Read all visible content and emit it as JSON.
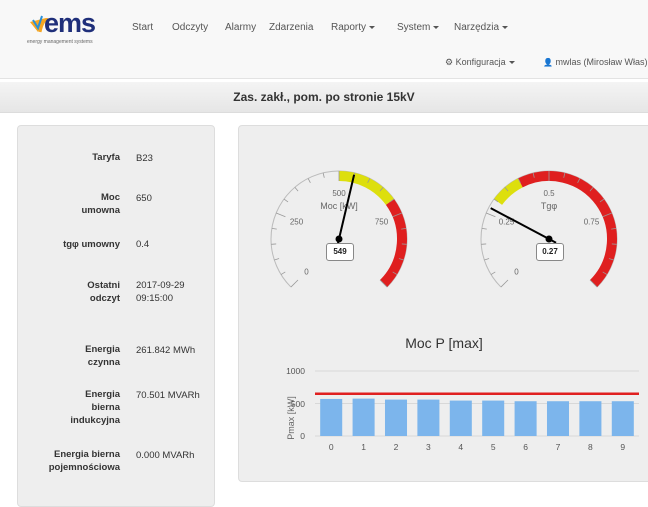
{
  "brand": {
    "name": "ems",
    "subtitle": "energy management systems"
  },
  "nav": {
    "items": [
      "Start",
      "Odczyty",
      "Alarmy",
      "Zdarzenia",
      "Raporty",
      "System",
      "Narzędzia"
    ],
    "config_label": "Konfiguracja",
    "user_label": "mwlas (Mirosław Włas)"
  },
  "page_title": "Zas. zakł., pom. po stronie 15kV",
  "params": [
    {
      "label": "Taryfa",
      "value": "B23"
    },
    {
      "label": "Moc umowna",
      "value": "650"
    },
    {
      "label": "tgφ umowny",
      "value": "0.4"
    },
    {
      "label": "Ostatni odczyt",
      "value": "2017-09-29 09:15:00"
    },
    {
      "label": "Energia czynna",
      "value": "261.842 MWh"
    },
    {
      "label": "Energia bierna indukcyjna",
      "value": "70.501 MVARh"
    },
    {
      "label": "Energia bierna pojemnościowa",
      "value": "0.000 MVARh"
    }
  ],
  "gauge_power": {
    "title": "Moc [kW]",
    "min": 0,
    "max": 1000,
    "value": 549,
    "ticks": [
      "0",
      "250",
      "500",
      "750"
    ],
    "value_text": "549"
  },
  "gauge_tg": {
    "title": "Tgφ",
    "min": 0,
    "max": 1,
    "value": 0.27,
    "ticks": [
      "0",
      "0.25",
      "0.5",
      "0.75"
    ],
    "value_text": "0.27"
  },
  "colors": {
    "yellow": "#dddf0d",
    "red": "#df1f1f",
    "bar": "#7cb5ec",
    "line": "#e02020"
  },
  "chart_data": {
    "type": "bar",
    "title": "Moc P [max]",
    "ylabel": "Pmax [kW]",
    "categories": [
      "0",
      "1",
      "2",
      "3",
      "4",
      "5",
      "6",
      "7",
      "8",
      "9"
    ],
    "values": [
      570,
      575,
      560,
      560,
      545,
      545,
      535,
      535,
      535,
      535
    ],
    "reference_line": 650,
    "ylim": [
      0,
      1000
    ],
    "yticks": [
      "0",
      "500",
      "1000"
    ]
  }
}
